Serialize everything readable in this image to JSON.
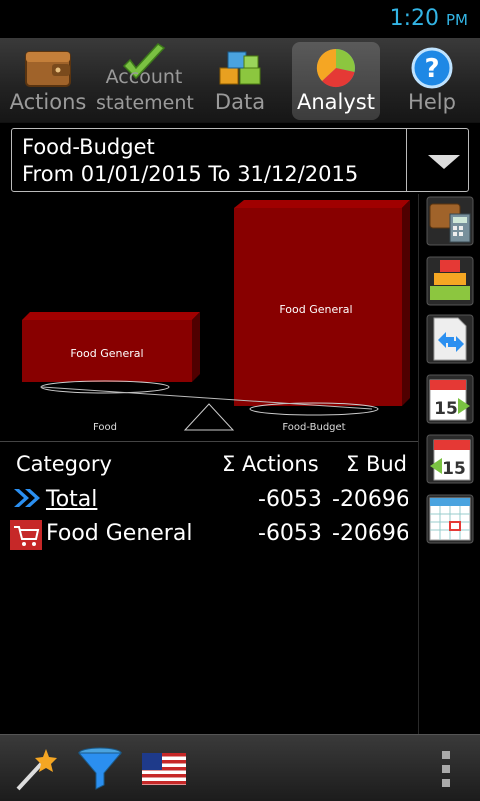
{
  "status": {
    "time": "1:20",
    "ampm": "PM"
  },
  "tabs": [
    {
      "label": "Actions",
      "icon": "wallet-icon"
    },
    {
      "label_line1": "Account",
      "label_line2": "statement",
      "icon": "checkmark-icon"
    },
    {
      "label": "Data",
      "icon": "blocks-icon"
    },
    {
      "label": "Analyst",
      "icon": "pie-chart-icon",
      "active": true
    },
    {
      "label": "Help",
      "icon": "help-icon"
    }
  ],
  "selector": {
    "title": "Food-Budget",
    "range": "From 01/01/2015 To 31/12/2015"
  },
  "chart": {
    "bars": [
      {
        "label": "Food General",
        "pan": "Food"
      },
      {
        "label": "Food General",
        "pan": "Food-Budget"
      }
    ]
  },
  "chart_data": {
    "type": "bar",
    "categories": [
      "Food",
      "Food-Budget"
    ],
    "series": [
      {
        "name": "Food General",
        "values": [
          6053,
          20696
        ]
      }
    ]
  },
  "table": {
    "headers": {
      "category": "Category",
      "actions": "Σ Actions",
      "budget": "Σ Budg"
    },
    "rows": [
      {
        "name": "Total",
        "actions": "-6053",
        "budget": "-20696",
        "icon": "double-chevron-icon"
      },
      {
        "name": "Food General",
        "actions": "-6053",
        "budget": "-20696",
        "icon": "cart-icon"
      }
    ]
  },
  "colors": {
    "accent": "#33b5e5",
    "bar": "#8b0000",
    "link": "#2b8ff0"
  }
}
